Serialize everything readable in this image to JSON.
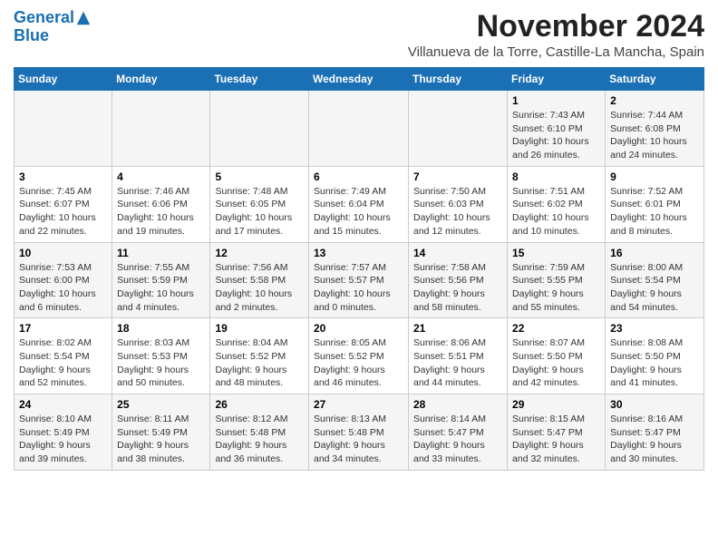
{
  "logo": {
    "line1": "General",
    "line2": "Blue"
  },
  "header": {
    "month": "November 2024",
    "location": "Villanueva de la Torre, Castille-La Mancha, Spain"
  },
  "weekdays": [
    "Sunday",
    "Monday",
    "Tuesday",
    "Wednesday",
    "Thursday",
    "Friday",
    "Saturday"
  ],
  "weeks": [
    [
      {
        "day": "",
        "info": ""
      },
      {
        "day": "",
        "info": ""
      },
      {
        "day": "",
        "info": ""
      },
      {
        "day": "",
        "info": ""
      },
      {
        "day": "",
        "info": ""
      },
      {
        "day": "1",
        "info": "Sunrise: 7:43 AM\nSunset: 6:10 PM\nDaylight: 10 hours and 26 minutes."
      },
      {
        "day": "2",
        "info": "Sunrise: 7:44 AM\nSunset: 6:08 PM\nDaylight: 10 hours and 24 minutes."
      }
    ],
    [
      {
        "day": "3",
        "info": "Sunrise: 7:45 AM\nSunset: 6:07 PM\nDaylight: 10 hours and 22 minutes."
      },
      {
        "day": "4",
        "info": "Sunrise: 7:46 AM\nSunset: 6:06 PM\nDaylight: 10 hours and 19 minutes."
      },
      {
        "day": "5",
        "info": "Sunrise: 7:48 AM\nSunset: 6:05 PM\nDaylight: 10 hours and 17 minutes."
      },
      {
        "day": "6",
        "info": "Sunrise: 7:49 AM\nSunset: 6:04 PM\nDaylight: 10 hours and 15 minutes."
      },
      {
        "day": "7",
        "info": "Sunrise: 7:50 AM\nSunset: 6:03 PM\nDaylight: 10 hours and 12 minutes."
      },
      {
        "day": "8",
        "info": "Sunrise: 7:51 AM\nSunset: 6:02 PM\nDaylight: 10 hours and 10 minutes."
      },
      {
        "day": "9",
        "info": "Sunrise: 7:52 AM\nSunset: 6:01 PM\nDaylight: 10 hours and 8 minutes."
      }
    ],
    [
      {
        "day": "10",
        "info": "Sunrise: 7:53 AM\nSunset: 6:00 PM\nDaylight: 10 hours and 6 minutes."
      },
      {
        "day": "11",
        "info": "Sunrise: 7:55 AM\nSunset: 5:59 PM\nDaylight: 10 hours and 4 minutes."
      },
      {
        "day": "12",
        "info": "Sunrise: 7:56 AM\nSunset: 5:58 PM\nDaylight: 10 hours and 2 minutes."
      },
      {
        "day": "13",
        "info": "Sunrise: 7:57 AM\nSunset: 5:57 PM\nDaylight: 10 hours and 0 minutes."
      },
      {
        "day": "14",
        "info": "Sunrise: 7:58 AM\nSunset: 5:56 PM\nDaylight: 9 hours and 58 minutes."
      },
      {
        "day": "15",
        "info": "Sunrise: 7:59 AM\nSunset: 5:55 PM\nDaylight: 9 hours and 55 minutes."
      },
      {
        "day": "16",
        "info": "Sunrise: 8:00 AM\nSunset: 5:54 PM\nDaylight: 9 hours and 54 minutes."
      }
    ],
    [
      {
        "day": "17",
        "info": "Sunrise: 8:02 AM\nSunset: 5:54 PM\nDaylight: 9 hours and 52 minutes."
      },
      {
        "day": "18",
        "info": "Sunrise: 8:03 AM\nSunset: 5:53 PM\nDaylight: 9 hours and 50 minutes."
      },
      {
        "day": "19",
        "info": "Sunrise: 8:04 AM\nSunset: 5:52 PM\nDaylight: 9 hours and 48 minutes."
      },
      {
        "day": "20",
        "info": "Sunrise: 8:05 AM\nSunset: 5:52 PM\nDaylight: 9 hours and 46 minutes."
      },
      {
        "day": "21",
        "info": "Sunrise: 8:06 AM\nSunset: 5:51 PM\nDaylight: 9 hours and 44 minutes."
      },
      {
        "day": "22",
        "info": "Sunrise: 8:07 AM\nSunset: 5:50 PM\nDaylight: 9 hours and 42 minutes."
      },
      {
        "day": "23",
        "info": "Sunrise: 8:08 AM\nSunset: 5:50 PM\nDaylight: 9 hours and 41 minutes."
      }
    ],
    [
      {
        "day": "24",
        "info": "Sunrise: 8:10 AM\nSunset: 5:49 PM\nDaylight: 9 hours and 39 minutes."
      },
      {
        "day": "25",
        "info": "Sunrise: 8:11 AM\nSunset: 5:49 PM\nDaylight: 9 hours and 38 minutes."
      },
      {
        "day": "26",
        "info": "Sunrise: 8:12 AM\nSunset: 5:48 PM\nDaylight: 9 hours and 36 minutes."
      },
      {
        "day": "27",
        "info": "Sunrise: 8:13 AM\nSunset: 5:48 PM\nDaylight: 9 hours and 34 minutes."
      },
      {
        "day": "28",
        "info": "Sunrise: 8:14 AM\nSunset: 5:47 PM\nDaylight: 9 hours and 33 minutes."
      },
      {
        "day": "29",
        "info": "Sunrise: 8:15 AM\nSunset: 5:47 PM\nDaylight: 9 hours and 32 minutes."
      },
      {
        "day": "30",
        "info": "Sunrise: 8:16 AM\nSunset: 5:47 PM\nDaylight: 9 hours and 30 minutes."
      }
    ]
  ]
}
